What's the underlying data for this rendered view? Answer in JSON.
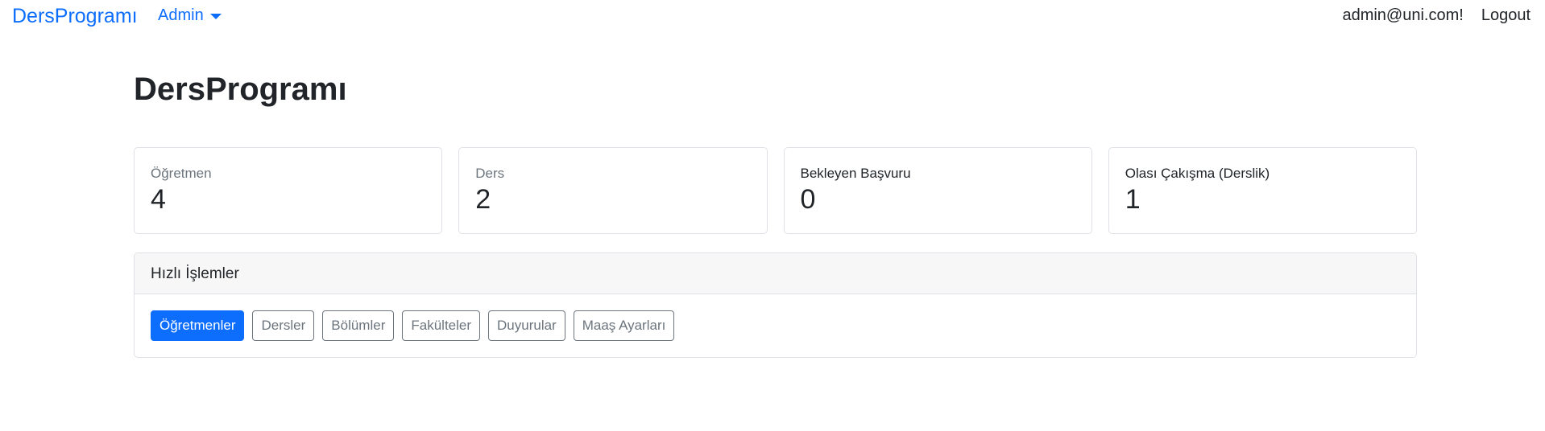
{
  "navbar": {
    "brand": "DersProgramı",
    "dropdown_label": "Admin",
    "user_email": "admin@uni.com!",
    "logout_label": "Logout"
  },
  "page": {
    "title": "DersProgramı"
  },
  "stats": [
    {
      "label": "Öğretmen",
      "value": "4"
    },
    {
      "label": "Ders",
      "value": "2"
    },
    {
      "label": "Bekleyen Başvuru",
      "value": "0"
    },
    {
      "label": "Olası Çakışma (Derslik)",
      "value": "1"
    }
  ],
  "quick_actions": {
    "title": "Hızlı İşlemler",
    "buttons": [
      {
        "label": "Öğretmenler"
      },
      {
        "label": "Dersler"
      },
      {
        "label": "Bölümler"
      },
      {
        "label": "Fakülteler"
      },
      {
        "label": "Duyurular"
      },
      {
        "label": "Maaş Ayarları"
      }
    ]
  },
  "colors": {
    "primary": "#0d6efd",
    "muted_text": "#6c757d",
    "border": "#dee2e6",
    "header_bg": "#f7f7f7"
  }
}
